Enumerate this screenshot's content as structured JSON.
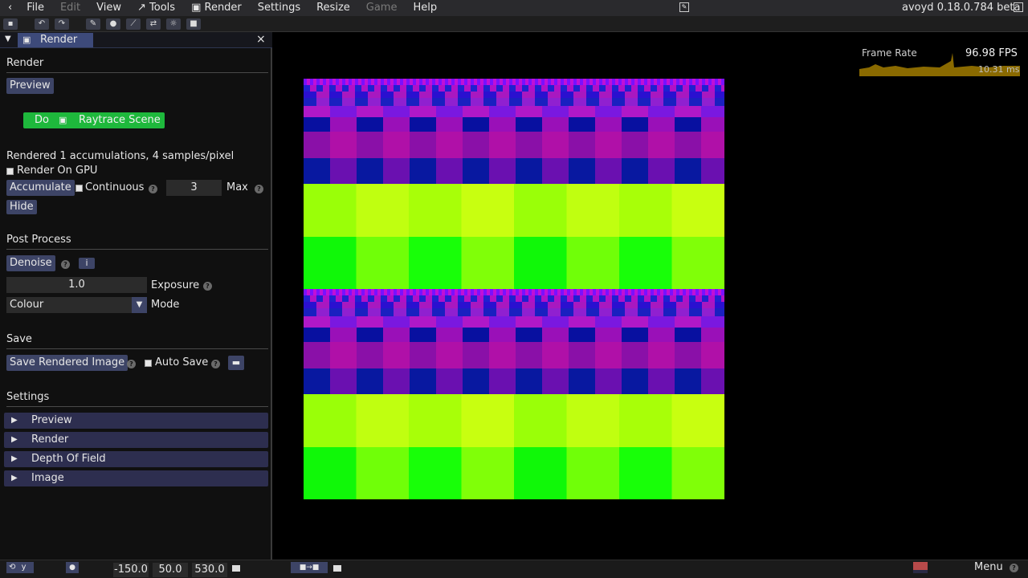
{
  "menubar": {
    "back_icon": "chevron-left-icon",
    "items": [
      {
        "label": "File"
      },
      {
        "label": "Edit",
        "disabled": true
      },
      {
        "label": "View"
      },
      {
        "label": "↗ Tools"
      },
      {
        "label": "▣ Render"
      },
      {
        "label": "Settings"
      },
      {
        "label": "Resize"
      },
      {
        "label": "Game",
        "disabled": true
      },
      {
        "label": "Help"
      }
    ],
    "version": "avoyd 0.18.0.784 beta"
  },
  "panel": {
    "tab_label": "Render",
    "render": {
      "heading": "Render",
      "preview_button": "Preview",
      "do_label": "Do",
      "raytrace_label": "Raytrace Scene",
      "status": "Rendered 1 accumulations, 4 samples/pixel",
      "render_on_gpu": "Render On GPU",
      "accumulate": "Accumulate",
      "continuous": "Continuous",
      "max_value": "3",
      "max_label": "Max",
      "hide": "Hide"
    },
    "post_process": {
      "heading": "Post Process",
      "denoise": "Denoise",
      "info": "i",
      "exposure_value": "1.0",
      "exposure_label": "Exposure",
      "mode_value": "Colour",
      "mode_label": "Mode"
    },
    "save": {
      "heading": "Save",
      "save_button": "Save Rendered Image",
      "auto_save": "Auto Save"
    },
    "settings": {
      "heading": "Settings",
      "folds": [
        "Preview",
        "Render",
        "Depth Of Field",
        "Image"
      ]
    }
  },
  "fps": {
    "label": "Frame Rate",
    "value": "96.98 FPS",
    "ms": "10.31 ms"
  },
  "statusbar": {
    "axis": "y",
    "x": "-150.0",
    "y": "50.0",
    "z": "530.0",
    "menu": "Menu"
  },
  "colors": {
    "accent": "#3d4466",
    "do_button": "#1eb83c",
    "swatch": "#b84a4a"
  }
}
